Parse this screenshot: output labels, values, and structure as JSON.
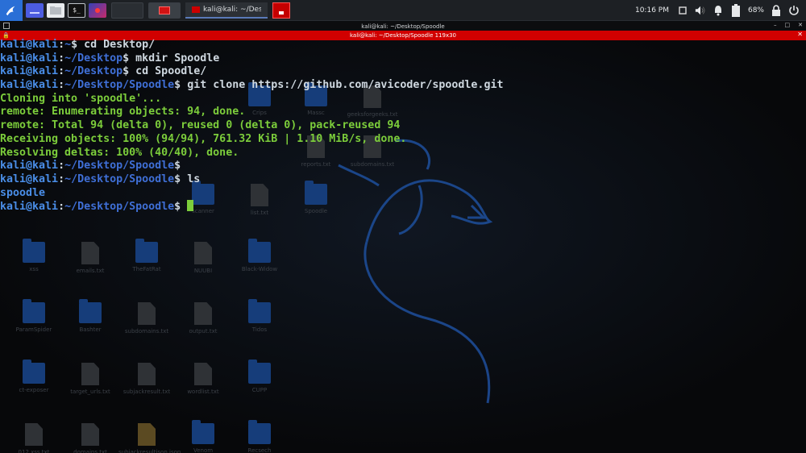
{
  "panel": {
    "task_title": "kali@kali: ~/Desktop/Sp",
    "clock": "10:16 PM",
    "battery": "68%",
    "terminal_glyph": "$_"
  },
  "window": {
    "title": "kali@kali: ~/Desktop/Spoodle",
    "tab_title": "kali@kali: ~/Desktop/Spoodle 119x30"
  },
  "terminal": {
    "lines": [
      {
        "kind": "prompt",
        "user": "kali@kali",
        "path": "~",
        "cmd": " cd Desktop/"
      },
      {
        "kind": "prompt",
        "user": "kali@kali",
        "path": "~/Desktop",
        "cmd": " mkdir Spoodle"
      },
      {
        "kind": "prompt",
        "user": "kali@kali",
        "path": "~/Desktop",
        "cmd": " cd Spoodle/"
      },
      {
        "kind": "prompt",
        "user": "kali@kali",
        "path": "~/Desktop/Spoodle",
        "cmd": " git clone https://github.com/avicoder/spoodle.git"
      },
      {
        "kind": "out",
        "text": "Cloning into 'spoodle'..."
      },
      {
        "kind": "out",
        "text": "remote: Enumerating objects: 94, done."
      },
      {
        "kind": "out",
        "text": "remote: Total 94 (delta 0), reused 0 (delta 0), pack-reused 94"
      },
      {
        "kind": "out",
        "text": "Receiving objects: 100% (94/94), 761.32 KiB | 1.10 MiB/s, done."
      },
      {
        "kind": "out",
        "text": "Resolving deltas: 100% (40/40), done."
      },
      {
        "kind": "prompt",
        "user": "kali@kali",
        "path": "~/Desktop/Spoodle",
        "cmd": ""
      },
      {
        "kind": "prompt",
        "user": "kali@kali",
        "path": "~/Desktop/Spoodle",
        "cmd": " ls"
      },
      {
        "kind": "dir",
        "text": "spoodle"
      },
      {
        "kind": "prompt",
        "user": "kali@kali",
        "path": "~/Desktop/Spoodle",
        "cmd": " ",
        "cursor": true
      }
    ]
  },
  "desktop_icons": [
    {
      "label": "Crips",
      "type": "folder"
    },
    {
      "label": "Massc",
      "type": "folder"
    },
    {
      "label": "geeksforgeeks.txt",
      "type": "file"
    },
    {
      "label": "reports.txt",
      "type": "file"
    },
    {
      "label": "subdomains.txt",
      "type": "file"
    },
    {
      "label": "scanner",
      "type": "folder"
    },
    {
      "label": "list.txt",
      "type": "file"
    },
    {
      "label": "Spoodle",
      "type": "folder"
    },
    {
      "label": "xss",
      "type": "folder"
    },
    {
      "label": "emails.txt",
      "type": "file"
    },
    {
      "label": "TheFatRat",
      "type": "folder"
    },
    {
      "label": "NUUBI",
      "type": "file"
    },
    {
      "label": "Black-Widow",
      "type": "folder"
    },
    {
      "label": "ParamSpider",
      "type": "folder"
    },
    {
      "label": "Bashter",
      "type": "folder"
    },
    {
      "label": "subdomains.txt",
      "type": "file"
    },
    {
      "label": "output.txt",
      "type": "file"
    },
    {
      "label": "Tidos",
      "type": "folder"
    },
    {
      "label": "ct-exposer",
      "type": "folder"
    },
    {
      "label": "target_urls.txt",
      "type": "file"
    },
    {
      "label": "subjackresult.txt",
      "type": "file"
    },
    {
      "label": "wordlist.txt",
      "type": "file"
    },
    {
      "label": "CUPP",
      "type": "folder"
    },
    {
      "label": "012 xss.txt",
      "type": "file"
    },
    {
      "label": "domains.txt",
      "type": "file"
    },
    {
      "label": "subjackresultjson.json",
      "type": "json"
    },
    {
      "label": "Venom",
      "type": "folder"
    },
    {
      "label": "Recsech",
      "type": "folder"
    }
  ],
  "colors": {
    "accent_red": "#d10000",
    "prompt_blue": "#4a8ee8",
    "output_green": "#7ccd3b"
  }
}
